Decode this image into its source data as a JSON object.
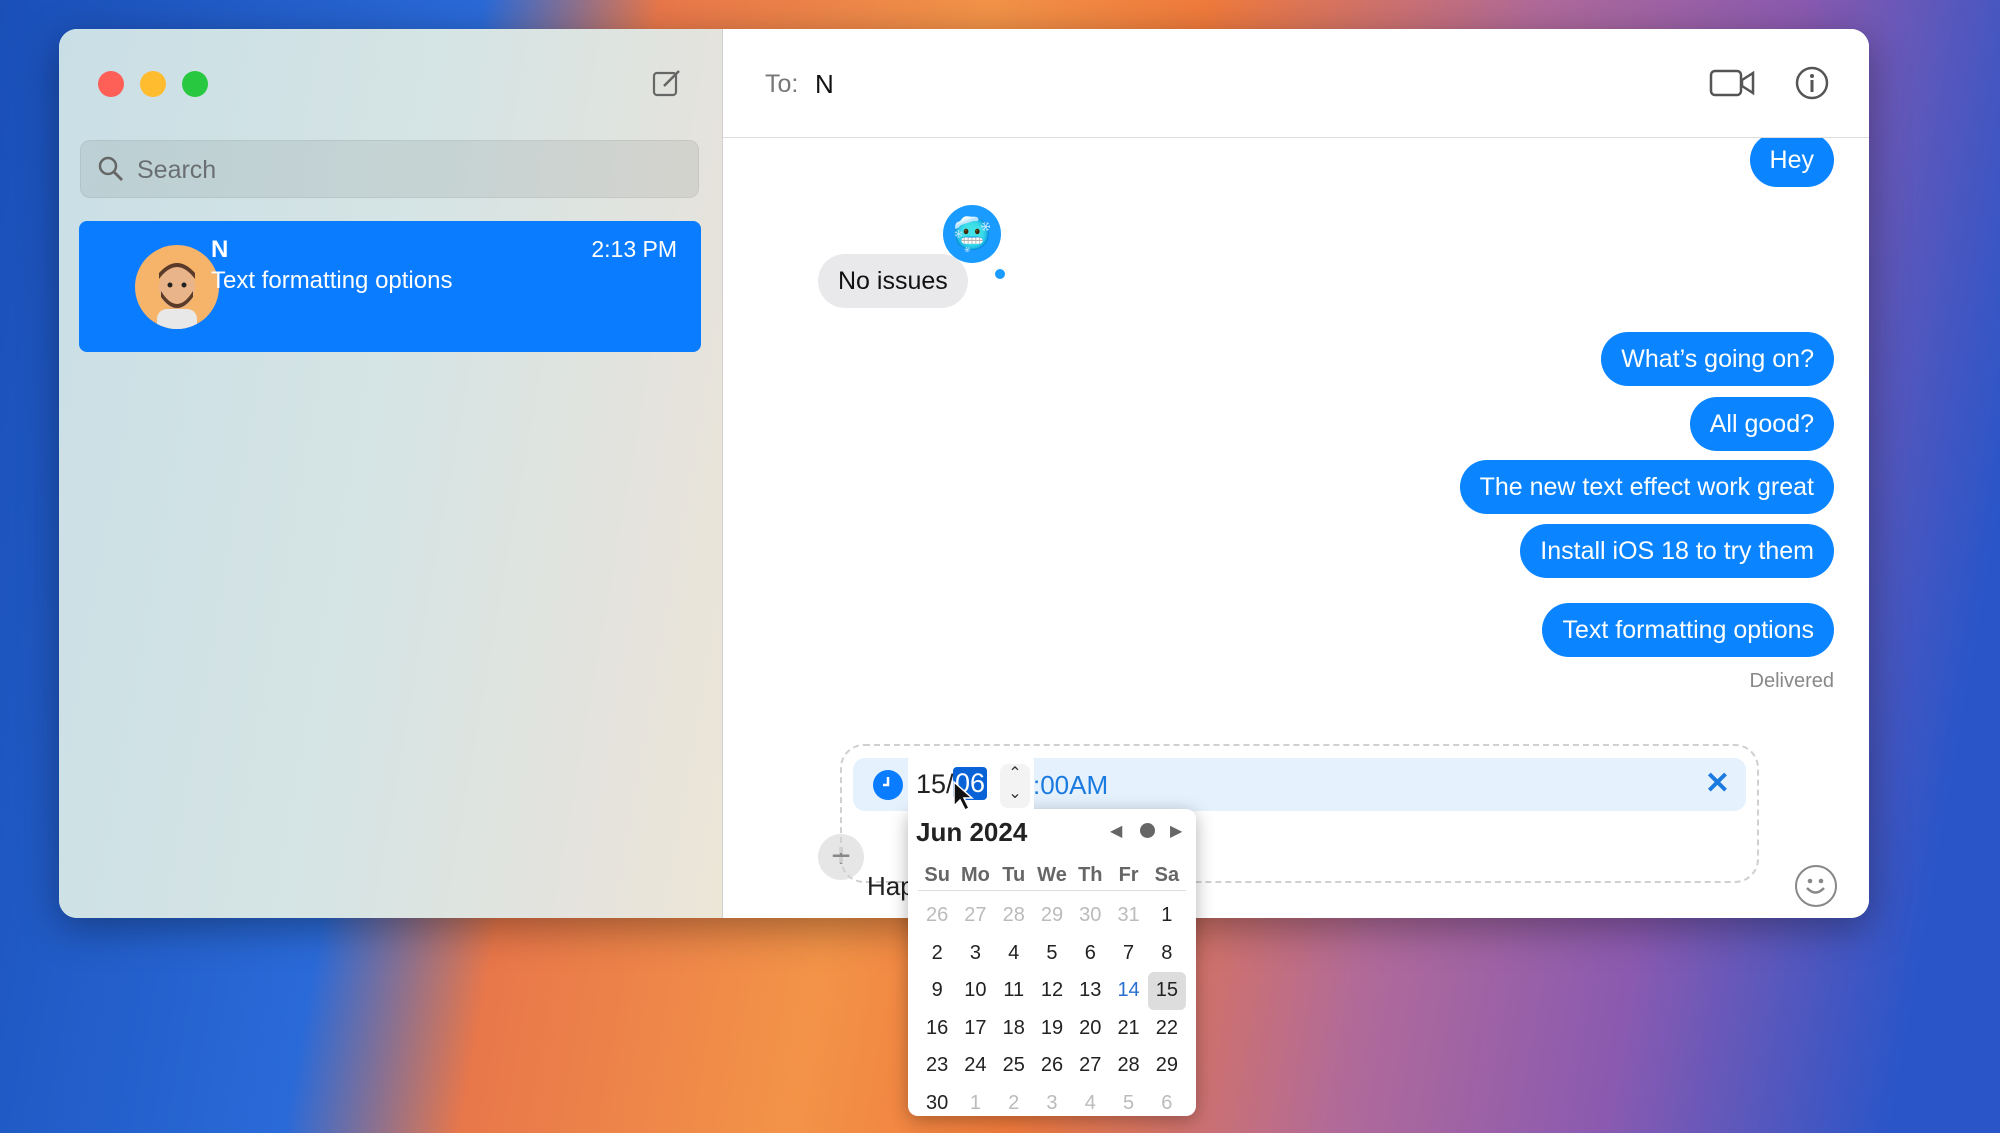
{
  "sidebar": {
    "search_placeholder": "Search",
    "conversations": [
      {
        "name": "N",
        "preview": "Text formatting options",
        "time": "2:13 PM"
      }
    ]
  },
  "header": {
    "to_label": "To:",
    "recipient": "N"
  },
  "messages": [
    {
      "text": "Hey",
      "from": "me"
    },
    {
      "text": "No issues",
      "from": "them",
      "tapback": "cold-face-emoji"
    },
    {
      "text": "What’s going on?",
      "from": "me"
    },
    {
      "text": "All good?",
      "from": "me"
    },
    {
      "text": "The new text effect work great",
      "from": "me"
    },
    {
      "text": "Install iOS 18 to try them",
      "from": "me"
    },
    {
      "text": "Text formatting options",
      "from": "me"
    }
  ],
  "status": "Delivered",
  "compose": {
    "draft": "Hap",
    "schedule": {
      "day": "15/",
      "month": "06",
      "time": ":00AM"
    }
  },
  "calendar": {
    "title": "Jun 2024",
    "weekdays": [
      "Su",
      "Mo",
      "Tu",
      "We",
      "Th",
      "Fr",
      "Sa"
    ],
    "days": [
      "26",
      "27",
      "28",
      "29",
      "30",
      "31",
      "1",
      "2",
      "3",
      "4",
      "5",
      "6",
      "7",
      "8",
      "9",
      "10",
      "11",
      "12",
      "13",
      "14",
      "15",
      "16",
      "17",
      "18",
      "19",
      "20",
      "21",
      "22",
      "23",
      "24",
      "25",
      "26",
      "27",
      "28",
      "29",
      "30",
      "1",
      "2",
      "3",
      "4",
      "5",
      "6"
    ],
    "today": "14",
    "selected": "15"
  },
  "colors": {
    "accent": "#0a84ff",
    "selected_row": "#0a7cff"
  }
}
